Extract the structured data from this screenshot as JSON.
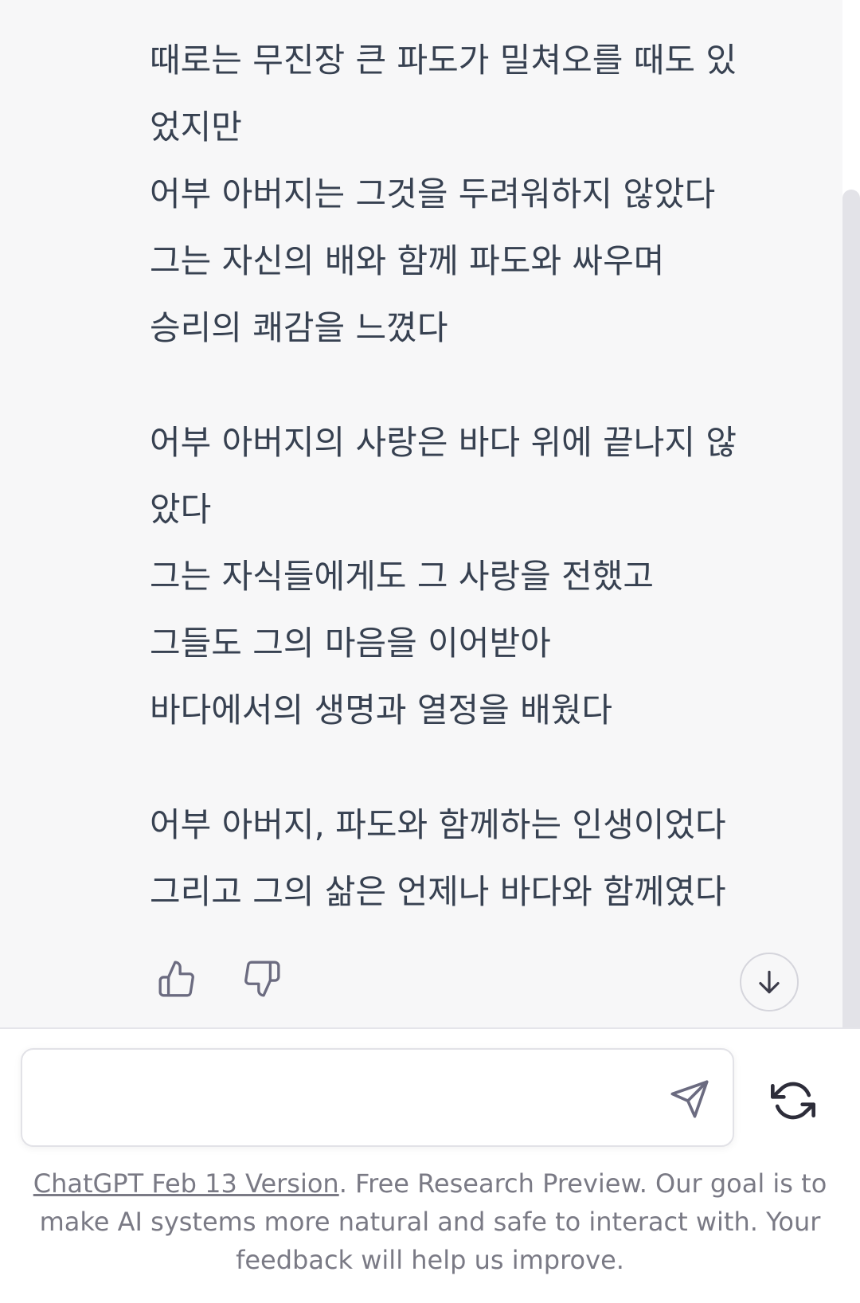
{
  "message": {
    "stanzas": [
      {
        "lines": [
          "때로는 무진장 큰 파도가 밀쳐오를 때도 있",
          "었지만",
          "어부 아버지는 그것을 두려워하지 않았다",
          "그는 자신의 배와 함께 파도와 싸우며",
          "승리의 쾌감을 느꼈다"
        ]
      },
      {
        "lines": [
          "어부 아버지의 사랑은 바다 위에 끝나지 않",
          "았다",
          "그는 자식들에게도 그 사랑을 전했고",
          "그들도 그의 마음을 이어받아",
          "바다에서의 생명과 열정을 배웠다"
        ]
      },
      {
        "lines": [
          "어부 아버지, 파도와 함께하는 인생이었다",
          "그리고 그의 삶은 언제나 바다와 함께였다"
        ]
      }
    ]
  },
  "feedback": {
    "thumbs_up_icon": "thumbs-up-icon",
    "thumbs_down_icon": "thumbs-down-icon"
  },
  "scroll_down_icon": "arrow-down-icon",
  "composer": {
    "value": "",
    "placeholder": "",
    "send_icon": "send-icon",
    "regenerate_icon": "refresh-icon"
  },
  "footer": {
    "link_text": "ChatGPT Feb 13 Version",
    "text": ". Free Research Preview. Our goal is to make AI systems more natural and safe to interact with. Your feedback will help us improve."
  },
  "colors": {
    "chat_background": "#f7f7f8",
    "text": "#374151",
    "icon": "#6b6b80",
    "footer_text": "#7a7a85",
    "border": "#e2e2e7"
  }
}
